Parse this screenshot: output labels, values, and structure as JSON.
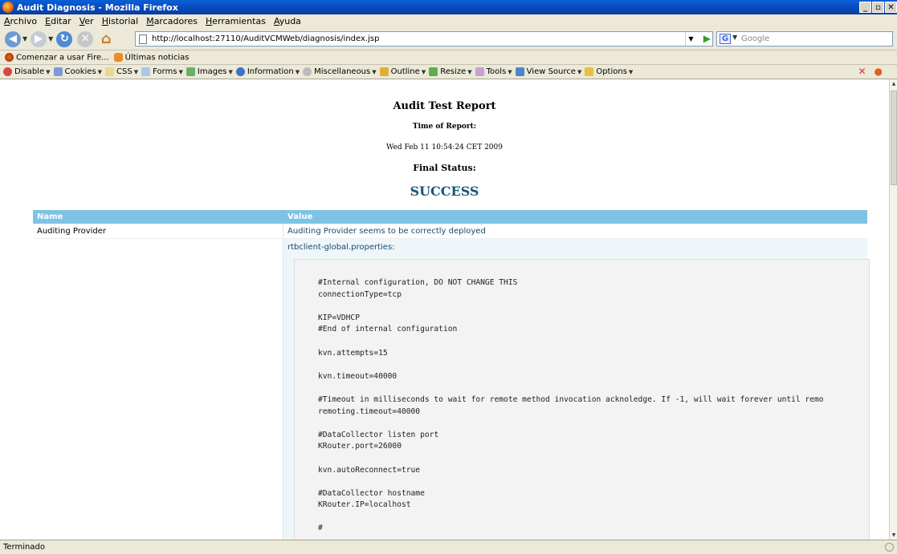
{
  "window": {
    "title": "Audit Diagnosis - Mozilla Firefox"
  },
  "menu": [
    "Archivo",
    "Editar",
    "Ver",
    "Historial",
    "Marcadores",
    "Herramientas",
    "Ayuda"
  ],
  "nav": {
    "url": "http://localhost:27110/AuditVCMWeb/diagnosis/index.jsp",
    "search_placeholder": "Google"
  },
  "bookmarks": [
    "Comenzar a usar Fire...",
    "Últimas noticias"
  ],
  "devtoolbar": [
    "Disable",
    "Cookies",
    "CSS",
    "Forms",
    "Images",
    "Information",
    "Miscellaneous",
    "Outline",
    "Resize",
    "Tools",
    "View Source",
    "Options"
  ],
  "report": {
    "title": "Audit Test Report",
    "time_label": "Time of Report:",
    "time_value": "Wed Feb 11 10:54:24 CET 2009",
    "final_label": "Final Status:",
    "status": "SUCCESS",
    "status_color": "#1a5878"
  },
  "table": {
    "headers": [
      "Name",
      "Value"
    ],
    "rows": [
      {
        "name": "Auditing Provider",
        "value": "Auditing Provider seems to be correctly deployed"
      }
    ],
    "props_label": "rtbclient-global.properties:",
    "props_content": "#Internal configuration, DO NOT CHANGE THIS\nconnectionType=tcp\n\nKIP=VDHCP\n#End of internal configuration\n\nkvn.attempts=15\n\nkvn.timeout=40000\n\n#Timeout in milliseconds to wait for remote method invocation acknoledge. If -1, will wait forever until remo\nremoting.timeout=40000\n\n#DataCollector listen port\nKRouter.port=26000\n\nkvn.autoReconnect=true\n\n#DataCollector hostname\nKRouter.IP=localhost\n\n#"
  },
  "statusbar": {
    "text": "Terminado"
  }
}
